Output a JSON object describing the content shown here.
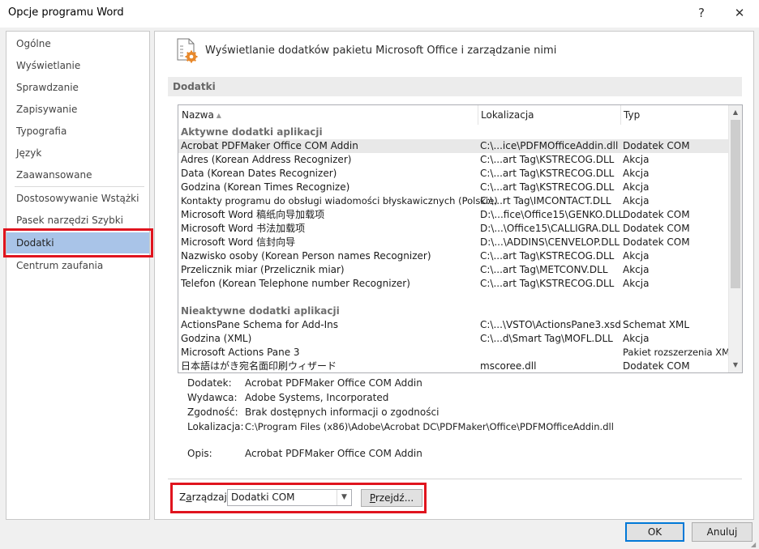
{
  "window": {
    "title": "Opcje programu Word",
    "help_glyph": "?",
    "close_glyph": "✕"
  },
  "sidebar": {
    "items": [
      {
        "label": "Ogólne"
      },
      {
        "label": "Wyświetlanie"
      },
      {
        "label": "Sprawdzanie"
      },
      {
        "label": "Zapisywanie"
      },
      {
        "label": "Typografia"
      },
      {
        "label": "Język"
      },
      {
        "label": "Zaawansowane"
      },
      {
        "label": "Dostosowywanie Wstążki"
      },
      {
        "label": "Pasek narzędzi Szybki dostęp"
      },
      {
        "label": "Dodatki"
      },
      {
        "label": "Centrum zaufania"
      }
    ],
    "selected": "Dodatki"
  },
  "main": {
    "header": "Wyświetlanie dodatków pakietu Microsoft Office i zarządzanie nimi",
    "section": "Dodatki",
    "columns": {
      "name": "Nazwa",
      "location": "Lokalizacja",
      "type": "Typ"
    },
    "groups": {
      "active": "Aktywne dodatki aplikacji",
      "inactive": "Nieaktywne dodatki aplikacji"
    },
    "active_rows": [
      {
        "name": "Acrobat PDFMaker Office COM Addin",
        "loc": "C:\\...ice\\PDFMOfficeAddin.dll",
        "type": "Dodatek COM"
      },
      {
        "name": "Adres (Korean Address Recognizer)",
        "loc": "C:\\...art Tag\\KSTRECOG.DLL",
        "type": "Akcja"
      },
      {
        "name": "Data (Korean Dates Recognizer)",
        "loc": "C:\\...art Tag\\KSTRECOG.DLL",
        "type": "Akcja"
      },
      {
        "name": "Godzina (Korean Times Recognize)",
        "loc": "C:\\...art Tag\\KSTRECOG.DLL",
        "type": "Akcja"
      },
      {
        "name": "Kontakty programu do obsługi wiadomości błyskawicznych (Polskie)",
        "loc": "C:\\...rt Tag\\IMCONTACT.DLL",
        "type": "Akcja"
      },
      {
        "name": "Microsoft Word 稿纸向导加载项",
        "loc": "D:\\...fice\\Office15\\GENKO.DLL",
        "type": "Dodatek COM"
      },
      {
        "name": "Microsoft Word 书法加载项",
        "loc": "D:\\...\\Office15\\CALLIGRA.DLL",
        "type": "Dodatek COM"
      },
      {
        "name": "Microsoft Word 信封向导",
        "loc": "D:\\...\\ADDINS\\CENVELOP.DLL",
        "type": "Dodatek COM"
      },
      {
        "name": "Nazwisko osoby (Korean Person names Recognizer)",
        "loc": "C:\\...art Tag\\KSTRECOG.DLL",
        "type": "Akcja"
      },
      {
        "name": "Przelicznik miar (Przelicznik miar)",
        "loc": "C:\\...art Tag\\METCONV.DLL",
        "type": "Akcja"
      },
      {
        "name": "Telefon (Korean Telephone number Recognizer)",
        "loc": "C:\\...art Tag\\KSTRECOG.DLL",
        "type": "Akcja"
      }
    ],
    "inactive_rows": [
      {
        "name": "ActionsPane Schema for Add-Ins",
        "loc": "C:\\...\\VSTO\\ActionsPane3.xsd",
        "type": "Schemat XML"
      },
      {
        "name": "Godzina (XML)",
        "loc": "C:\\...d\\Smart Tag\\MOFL.DLL",
        "type": "Akcja"
      },
      {
        "name": "Microsoft Actions Pane 3",
        "loc": "",
        "type": "Pakiet rozszerzenia XML"
      },
      {
        "name": "日本語はがき宛名面印刷ウィザード",
        "loc": "mscoree.dll",
        "type": "Dodatek COM"
      }
    ],
    "details": {
      "addin_label": "Dodatek:",
      "addin": "Acrobat PDFMaker Office COM Addin",
      "publisher_label": "Wydawca:",
      "publisher": "Adobe Systems, Incorporated",
      "compat_label": "Zgodność:",
      "compat": "Brak dostępnych informacji o zgodności",
      "location_label": "Lokalizacja:",
      "location": "C:\\Program Files (x86)\\Adobe\\Acrobat DC\\PDFMaker\\Office\\PDFMOfficeAddin.dll",
      "desc_label": "Opis:",
      "desc": "Acrobat PDFMaker Office COM Addin"
    },
    "manage": {
      "label_pre": "Z",
      "label_ul": "a",
      "label_post": "rządzaj:",
      "selected": "Dodatki COM",
      "go_ul": "P",
      "go_post": "rzejdź..."
    }
  },
  "footer": {
    "ok": "OK",
    "cancel": "Anuluj"
  },
  "colors": {
    "highlight_box": "#e0141e",
    "selected_nav": "#a9c4e8",
    "focus_border": "#0078d7"
  }
}
